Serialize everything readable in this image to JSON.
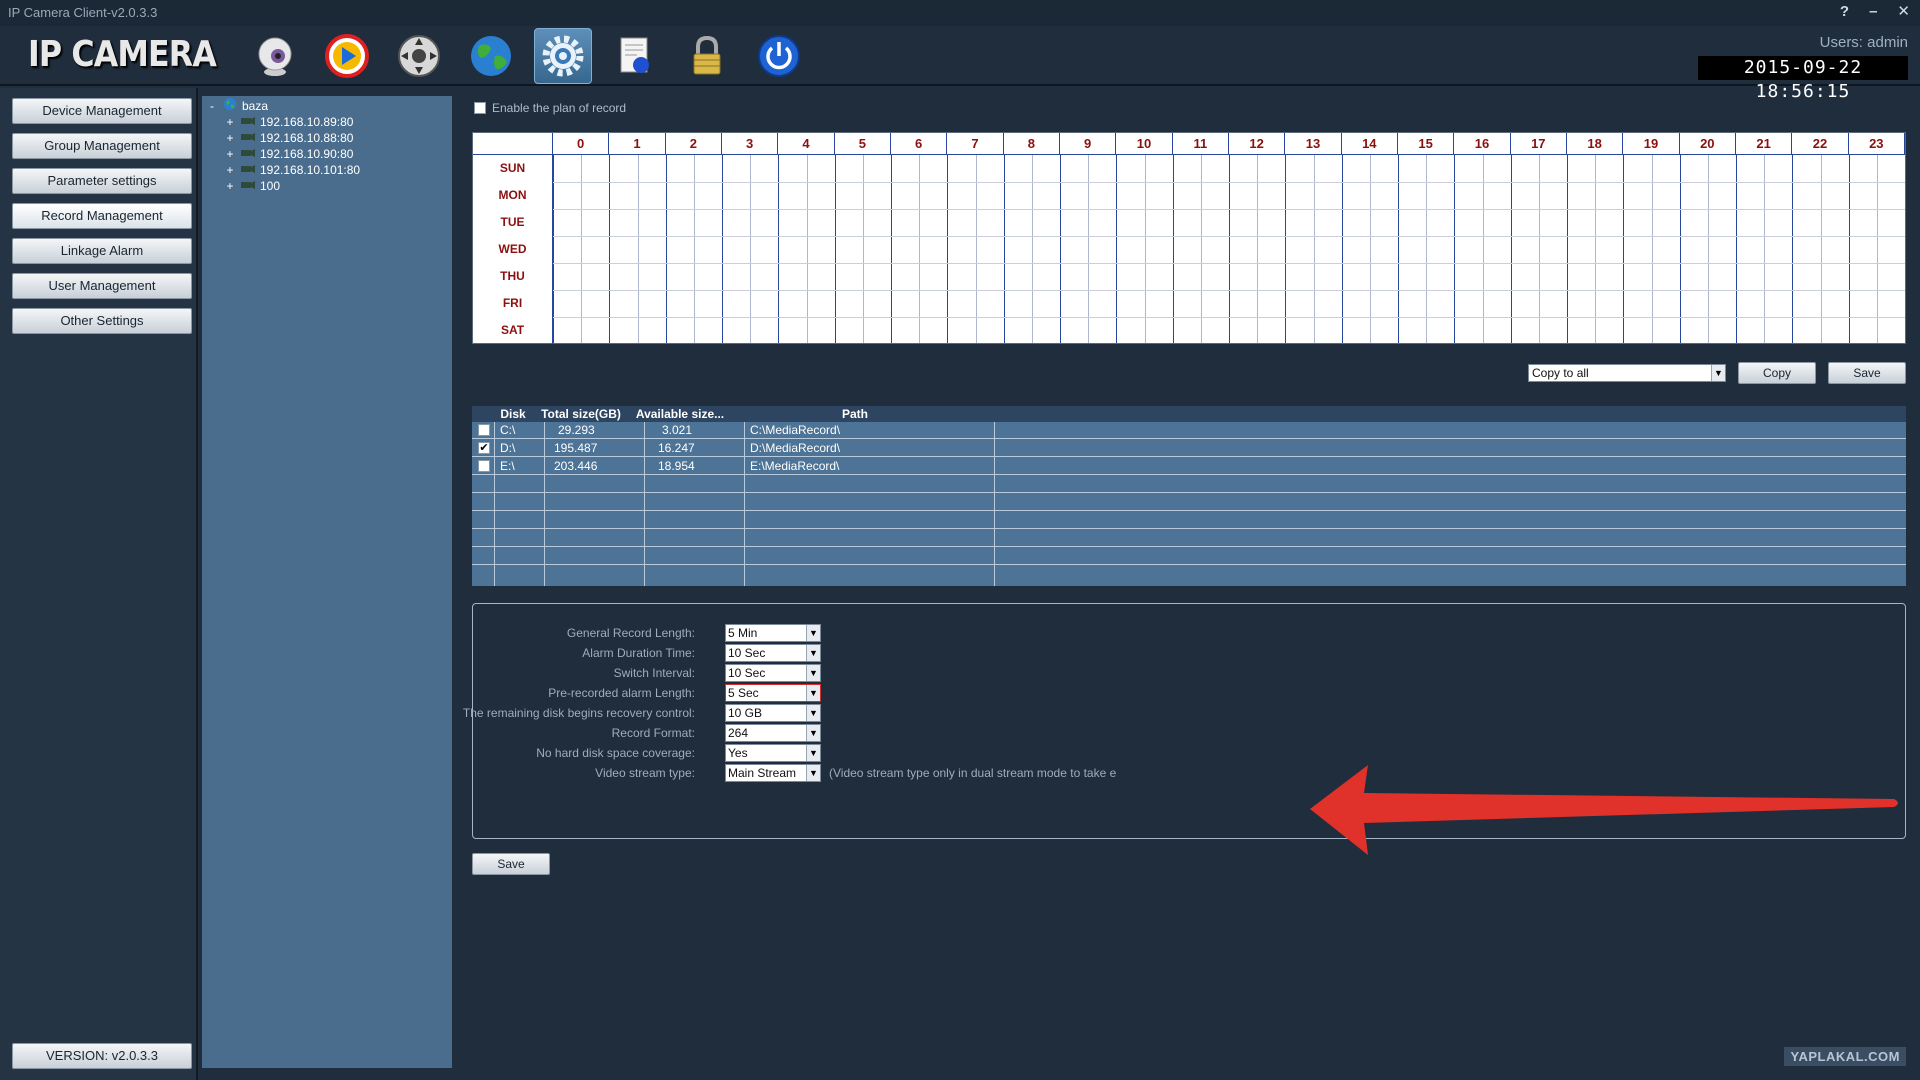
{
  "window": {
    "title": "IP Camera Client-v2.0.3.3",
    "controls": [
      "?",
      "–",
      "✕"
    ]
  },
  "header": {
    "logo": "IP CAMERA",
    "users": "Users: admin",
    "datetime": "2015-09-22 18:56:15",
    "toolbar_icons": [
      "webcam-icon",
      "play-icon",
      "ptz-control-icon",
      "globe-icon",
      "settings-gear-icon",
      "log-document-icon",
      "lock-icon",
      "power-icon"
    ],
    "active_tool": "settings-gear-icon"
  },
  "sidebar": {
    "items": [
      {
        "label": "Device Management"
      },
      {
        "label": "Group Management"
      },
      {
        "label": "Parameter settings"
      },
      {
        "label": "Record Management",
        "active": true
      },
      {
        "label": "Linkage Alarm"
      },
      {
        "label": "User Management"
      },
      {
        "label": "Other Settings"
      }
    ],
    "version": "VERSION: v2.0.3.3"
  },
  "tree": {
    "root": {
      "expander": "-",
      "label": "baza"
    },
    "children": [
      {
        "expander": "+",
        "label": "192.168.10.89:80"
      },
      {
        "expander": "+",
        "label": "192.168.10.88:80"
      },
      {
        "expander": "+",
        "label": "192.168.10.90:80"
      },
      {
        "expander": "+",
        "label": "192.168.10.101:80"
      },
      {
        "expander": "+",
        "label": "100"
      }
    ]
  },
  "record": {
    "enable_plan_label": "Enable the plan of record",
    "enable_plan_checked": false,
    "hours": [
      "0",
      "1",
      "2",
      "3",
      "4",
      "5",
      "6",
      "7",
      "8",
      "9",
      "10",
      "11",
      "12",
      "13",
      "14",
      "15",
      "16",
      "17",
      "18",
      "19",
      "20",
      "21",
      "22",
      "23"
    ],
    "days": [
      "SUN",
      "MON",
      "TUE",
      "WED",
      "THU",
      "FRI",
      "SAT"
    ],
    "copy_select_value": "Copy to all",
    "copy_button": "Copy",
    "save_button": "Save"
  },
  "disk_table": {
    "headers": [
      "Disk",
      "Total size(GB)",
      "Available size...",
      "Path"
    ],
    "rows": [
      {
        "checked": false,
        "disk": "C:\\",
        "total": "29.293",
        "available": "3.021",
        "path": "C:\\MediaRecord\\"
      },
      {
        "checked": true,
        "disk": "D:\\",
        "total": "195.487",
        "available": "16.247",
        "path": "D:\\MediaRecord\\"
      },
      {
        "checked": false,
        "disk": "E:\\",
        "total": "203.446",
        "available": "18.954",
        "path": "E:\\MediaRecord\\"
      }
    ]
  },
  "params": {
    "rows": [
      {
        "label": "General Record Length:",
        "value": "5 Min"
      },
      {
        "label": "Alarm Duration Time:",
        "value": "10 Sec"
      },
      {
        "label": "Switch Interval:",
        "value": "10 Sec"
      },
      {
        "label": "Pre-recorded alarm Length:",
        "value": "5 Sec",
        "highlighted": true
      },
      {
        "label": "The remaining disk begins recovery control:",
        "value": "10 GB"
      },
      {
        "label": "Record Format:",
        "value": "264"
      },
      {
        "label": "No hard disk space coverage:",
        "value": "Yes"
      },
      {
        "label": "Video stream type:",
        "value": "Main Stream"
      }
    ],
    "note": "(Video stream type only in dual stream mode to take e",
    "save_button": "Save"
  },
  "annotation_arrow_color": "#e0322a",
  "watermark": "YAPLAKAL.COM"
}
